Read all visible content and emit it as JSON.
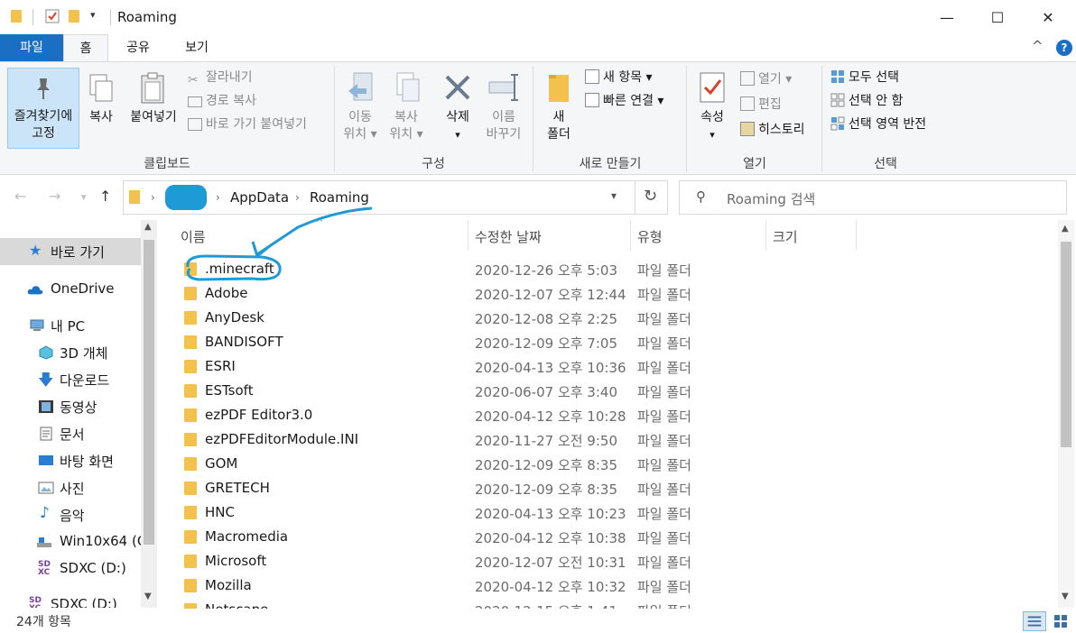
{
  "window": {
    "title": "Roaming",
    "minimize_glyph": "—",
    "maximize_glyph": "☐",
    "close_glyph": "✕"
  },
  "tabs": [
    {
      "label": "파일"
    },
    {
      "label": "홈"
    },
    {
      "label": "공유"
    },
    {
      "label": "보기"
    }
  ],
  "ribbon": {
    "collapse_glyph": "^",
    "help_glyph": "?",
    "clipboard": {
      "pin_line1": "즐겨찾기에",
      "pin_line2": "고정",
      "copy": "복사",
      "paste": "붙여넣기",
      "cut": "잘라내기",
      "copy_path": "경로 복사",
      "paste_shortcut": "바로 가기 붙여넣기",
      "group": "클립보드"
    },
    "organize": {
      "move_line1": "이동",
      "move_line2": "위치",
      "copy_line1": "복사",
      "copy_line2": "위치",
      "delete": "삭제",
      "rename_line1": "이름",
      "rename_line2": "바꾸기",
      "group": "구성"
    },
    "new": {
      "folder_line1": "새",
      "folder_line2": "폴더",
      "new_item": "새 항목",
      "easy_access": "빠른 연결",
      "group": "새로 만들기"
    },
    "open": {
      "properties": "속성",
      "open": "열기",
      "edit": "편집",
      "history": "히스토리",
      "group": "열기"
    },
    "select": {
      "select_all": "모두 선택",
      "select_none": "선택 안 함",
      "invert": "선택 영역 반전",
      "group": "선택"
    }
  },
  "address": {
    "crumbs": [
      "AppData",
      "Roaming"
    ],
    "search_placeholder": "Roaming 검색"
  },
  "nav": [
    {
      "label": "바로 가기",
      "icon": "star-icon"
    },
    {
      "label": "OneDrive",
      "icon": "cloud-icon"
    },
    {
      "label": "내 PC",
      "icon": "pc-icon"
    },
    {
      "label": "3D 개체",
      "icon": "cube-icon"
    },
    {
      "label": "다운로드",
      "icon": "download-icon"
    },
    {
      "label": "동영상",
      "icon": "video-icon"
    },
    {
      "label": "문서",
      "icon": "document-icon"
    },
    {
      "label": "바탕 화면",
      "icon": "desktop-icon"
    },
    {
      "label": "사진",
      "icon": "picture-icon"
    },
    {
      "label": "음악",
      "icon": "music-icon"
    },
    {
      "label": "Win10x64 (C",
      "icon": "drive-icon"
    },
    {
      "label": "SDXC (D:)",
      "icon": "sd-card-icon"
    },
    {
      "label": "SDXC (D:)",
      "icon": "sd-card-icon"
    }
  ],
  "columns": {
    "name": "이름",
    "date": "수정한 날짜",
    "type": "유형",
    "size": "크기"
  },
  "files": [
    {
      "name": ".minecraft",
      "date": "2020-12-26 오후 5:03",
      "type": "파일 폴더"
    },
    {
      "name": "Adobe",
      "date": "2020-12-07 오후 12:44",
      "type": "파일 폴더"
    },
    {
      "name": "AnyDesk",
      "date": "2020-12-08 오후 2:25",
      "type": "파일 폴더"
    },
    {
      "name": "BANDISOFT",
      "date": "2020-12-09 오후 7:05",
      "type": "파일 폴더"
    },
    {
      "name": "ESRI",
      "date": "2020-04-13 오후 10:36",
      "type": "파일 폴더"
    },
    {
      "name": "ESTsoft",
      "date": "2020-06-07 오후 3:40",
      "type": "파일 폴더"
    },
    {
      "name": "ezPDF Editor3.0",
      "date": "2020-04-12 오후 10:28",
      "type": "파일 폴더"
    },
    {
      "name": "ezPDFEditorModule.INI",
      "date": "2020-11-27 오전 9:50",
      "type": "파일 폴더"
    },
    {
      "name": "GOM",
      "date": "2020-12-09 오후 8:35",
      "type": "파일 폴더"
    },
    {
      "name": "GRETECH",
      "date": "2020-12-09 오후 8:35",
      "type": "파일 폴더"
    },
    {
      "name": "HNC",
      "date": "2020-04-13 오후 10:23",
      "type": "파일 폴더"
    },
    {
      "name": "Macromedia",
      "date": "2020-04-12 오후 10:38",
      "type": "파일 폴더"
    },
    {
      "name": "Microsoft",
      "date": "2020-12-07 오전 10:31",
      "type": "파일 폴더"
    },
    {
      "name": "Mozilla",
      "date": "2020-04-12 오후 10:32",
      "type": "파일 폴더"
    },
    {
      "name": "Netscape",
      "date": "2020-12-15 오후 1:41",
      "type": "파일 폴더"
    }
  ],
  "status": {
    "count": "24개 항목"
  },
  "colors": {
    "file_tab": "#1a6fc4",
    "annotation": "#1e9bd7",
    "folder": "#f2c14e"
  }
}
